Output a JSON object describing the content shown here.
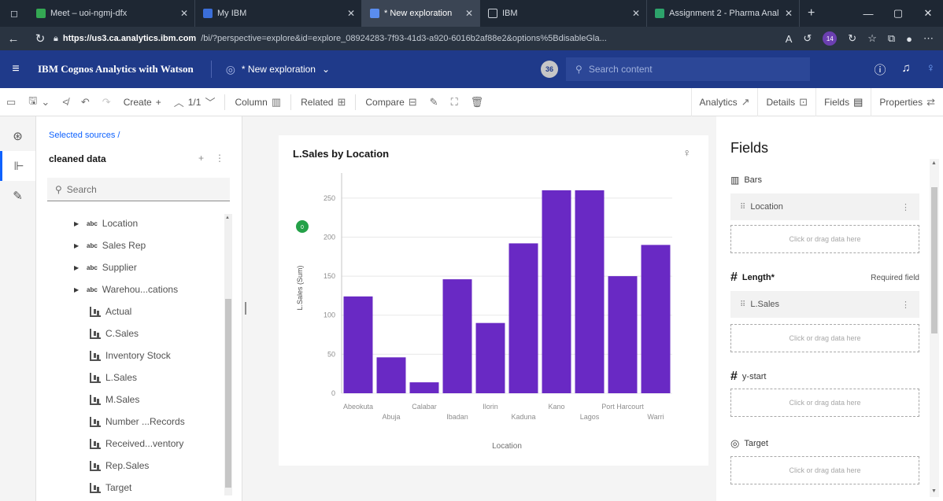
{
  "browser": {
    "tabs": [
      {
        "label": "Meet – uoi-ngmj-dfx",
        "color": "#34a853"
      },
      {
        "label": "My IBM",
        "color": "#3b6ed8"
      },
      {
        "label": "* New exploration",
        "color": "#5a8dee"
      },
      {
        "label": "IBM",
        "color": "#8d8d8d"
      },
      {
        "label": "Assignment 2 - Pharma Anal",
        "color": "#2da36b"
      }
    ],
    "new_tab": "+",
    "url_host": "https://us3.ca.analytics.ibm.com",
    "url_path": "/bi/?perspective=explore&id=explore_08924283-7f93-41d3-a920-6016b2af88e2&options%5BdisableGla...",
    "profile_badge": "14"
  },
  "app": {
    "brand": "IBM Cognos Analytics with Watson",
    "exploration_title": "* New exploration",
    "notification_count": "36",
    "search_placeholder": "Search content"
  },
  "toolbar": {
    "create": "Create",
    "page_indicator": "1/1",
    "column": "Column",
    "related": "Related",
    "compare": "Compare",
    "analytics": "Analytics",
    "details": "Details",
    "fields": "Fields",
    "properties": "Properties"
  },
  "sources": {
    "breadcrumb": "Selected sources /",
    "source_name": "cleaned data",
    "search_placeholder": "Search",
    "dimensions": [
      "Location",
      "Sales Rep",
      "Supplier",
      "Warehou...cations"
    ],
    "measures": [
      "Actual",
      "C.Sales",
      "Inventory Stock",
      "L.Sales",
      "M.Sales",
      "Number ...Records",
      "Received...ventory",
      "Rep.Sales",
      "Target"
    ],
    "dim_tag": "abc"
  },
  "chart": {
    "title": "L.Sales by Location",
    "badge": "0"
  },
  "chart_data": {
    "type": "bar",
    "title": "L.Sales by Location",
    "xlabel": "Location",
    "ylabel": "L.Sales (Sum)",
    "categories": [
      "Abeokuta",
      "Abuja",
      "Calabar",
      "Ibadan",
      "Ilorin",
      "Kaduna",
      "Kano",
      "Lagos",
      "Port Harcourt",
      "Warri"
    ],
    "values": [
      124,
      46,
      14,
      146,
      90,
      192,
      260,
      260,
      150,
      190
    ],
    "ylim": [
      0,
      270
    ],
    "yticks": [
      0,
      50,
      100,
      150,
      200,
      250
    ],
    "bar_color": "#6929c4",
    "grid": true
  },
  "fields_panel": {
    "title": "Fields",
    "bars_label": "Bars",
    "bars_value": "Location",
    "length_label": "Length*",
    "required": "Required field",
    "length_value": "L.Sales",
    "ystart_label": "y-start",
    "target_label": "Target",
    "drop_hint": "Click or drag data here"
  }
}
